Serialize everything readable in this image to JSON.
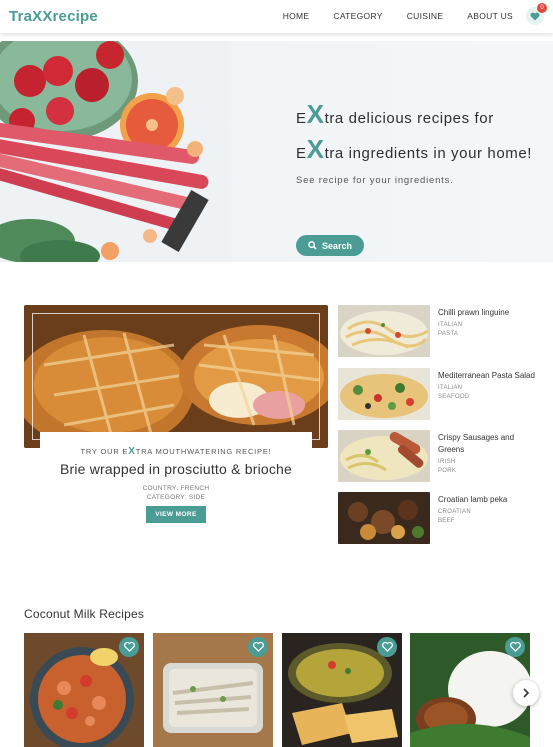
{
  "brand": "TraXXrecipe",
  "nav": {
    "items": [
      "HOME",
      "CATEGORY",
      "CUISINE",
      "ABOUT US"
    ],
    "favorites_count": "0"
  },
  "hero": {
    "line1_x": "X",
    "line1_prefix": "E",
    "line1_rest": "tra delicious recipes for",
    "line2_x": "X",
    "line2_prefix": "E",
    "line2_rest": "tra ingredients in your home!",
    "subtitle": "See recipe for your ingredients.",
    "search_label": "Search"
  },
  "featured": {
    "kicker_pre": "TRY OUR E",
    "kicker_x": "X",
    "kicker_post": "TRA MOUTHWATERING RECIPE!",
    "title": "Brie wrapped in prosciutto & brioche",
    "country": "COUNTRY: FRENCH",
    "category": "CATEGORY: SIDE",
    "button": "VIEW MORE"
  },
  "side_list": [
    {
      "title": "Chilli prawn linguine",
      "tag1": "ITALIAN",
      "tag2": "PASTA"
    },
    {
      "title": "Mediterranean Pasta Salad",
      "tag1": "ITALIAN",
      "tag2": "SEAFOOD"
    },
    {
      "title": "Crispy Sausages and Greens",
      "tag1": "IRISH",
      "tag2": "PORK"
    },
    {
      "title": "Croatian lamb peka",
      "tag1": "CROATIAN",
      "tag2": "BEEF"
    }
  ],
  "coconut": {
    "title": "Coconut Milk Recipes"
  },
  "colors": {
    "accent": "#4a9c94",
    "badge": "#e0483d"
  },
  "icons": [
    "heart-icon",
    "search-icon",
    "chevron-right-icon"
  ]
}
